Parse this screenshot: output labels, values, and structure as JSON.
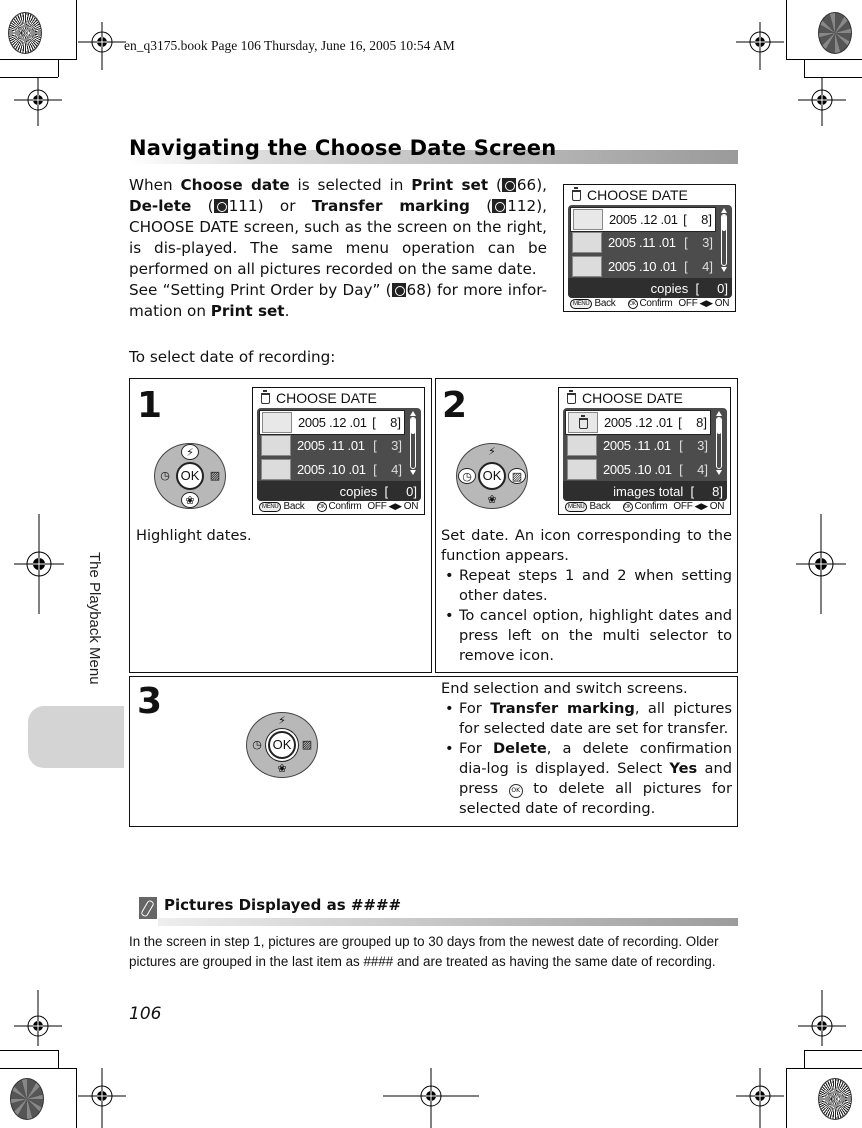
{
  "print_header": "en_q3175.book  Page 106  Thursday, June 16, 2005  10:54 AM",
  "side_tab_label": "The Playback Menu",
  "title": "Navigating the Choose Date Screen",
  "intro": {
    "p1_segments": [
      {
        "t": "When ",
        "b": false
      },
      {
        "t": "Choose date",
        "b": true
      },
      {
        "t": " is selected in ",
        "b": false
      },
      {
        "t": "Print set",
        "b": true
      },
      {
        "t": " (",
        "b": false
      },
      {
        "ref": "66"
      },
      {
        "t": "), ",
        "b": false
      },
      {
        "t": "De-lete",
        "b": true
      },
      {
        "t": " (",
        "b": false
      },
      {
        "ref": "111"
      },
      {
        "t": ") or ",
        "b": false
      },
      {
        "t": "Transfer marking",
        "b": true
      },
      {
        "t": " (",
        "b": false
      },
      {
        "ref": "112"
      },
      {
        "t": "), CHOOSE DATE screen, such as the screen on the right, is dis-played. The same menu operation can be performed on all pictures recorded on the same date.",
        "b": false
      }
    ],
    "p2_segments": [
      {
        "t": "See “Setting Print Order by Day” (",
        "b": false
      },
      {
        "ref": "68"
      },
      {
        "t": ") for more infor-mation on ",
        "b": false
      },
      {
        "t": "Print set",
        "b": true
      },
      {
        "t": ".",
        "b": false
      }
    ]
  },
  "lead": "To select date of recording:",
  "screens": {
    "intro": {
      "title": "CHOOSE DATE",
      "rows": [
        {
          "date": "2005 .12 .01",
          "count": "[    8]",
          "selected": true,
          "icon": false
        },
        {
          "date": "2005 .11 .01",
          "count": "[    3]",
          "selected": false,
          "icon": false
        },
        {
          "date": "2005 .10 .01",
          "count": "[    4]",
          "selected": false,
          "icon": false
        }
      ],
      "footer_label": "copies  [     0]",
      "bottom": {
        "back": "Back",
        "menu": "MENU",
        "ok": "OK",
        "confirm": "Confirm",
        "off": "OFF",
        "on": "ON"
      }
    },
    "step1": {
      "title": "CHOOSE DATE",
      "rows": [
        {
          "date": "2005 .12 .01",
          "count": "[    8]",
          "selected": true,
          "icon": false
        },
        {
          "date": "2005 .11 .01",
          "count": "[    3]",
          "selected": false,
          "icon": false
        },
        {
          "date": "2005 .10 .01",
          "count": "[    4]",
          "selected": false,
          "icon": false
        }
      ],
      "footer_label": "copies  [     0]",
      "bottom": {
        "back": "Back",
        "menu": "MENU",
        "ok": "OK",
        "confirm": "Confirm",
        "off": "OFF",
        "on": "ON"
      }
    },
    "step2": {
      "title": "CHOOSE DATE",
      "rows": [
        {
          "date": "2005 .12 .01",
          "count": "[    8]",
          "selected": true,
          "icon": true
        },
        {
          "date": "2005 .11 .01",
          "count": "[    3]",
          "selected": false,
          "icon": false
        },
        {
          "date": "2005 .10 .01",
          "count": "[    4]",
          "selected": false,
          "icon": false
        }
      ],
      "footer_label": "images total  [     8]",
      "bottom": {
        "back": "Back",
        "menu": "MENU",
        "ok": "OK",
        "confirm": "Confirm",
        "off": "OFF",
        "on": "ON"
      }
    }
  },
  "selector": {
    "ok": "OK",
    "up": "flash-icon",
    "down": "macro-icon",
    "left": "self-timer-icon",
    "right": "exposure-comp-icon"
  },
  "steps": [
    {
      "number": "1",
      "text": "Highlight dates.",
      "highlighted_buttons": [
        "up",
        "down"
      ]
    },
    {
      "number": "2",
      "intro": "Set date. An icon corresponding to the function appears.",
      "bullets": [
        "Repeat steps 1 and 2 when setting other dates.",
        "To cancel option, highlight dates and press left on the multi selector to remove icon."
      ],
      "highlighted_buttons": [
        "left",
        "right"
      ]
    },
    {
      "number": "3",
      "intro": "End selection and switch screens.",
      "bullet1": {
        "pre": "For ",
        "bold": "Transfer marking",
        "post": ", all pictures for selected date are set for transfer."
      },
      "bullet2": {
        "pre": "For ",
        "bold": "Delete",
        "mid": ", a delete confirmation dia-log is displayed. Select ",
        "bold2": "Yes",
        "mid2": " and press ",
        "ok": "OK",
        "post": " to delete all pictures for selected date of recording."
      },
      "highlighted_buttons": [
        "ok"
      ]
    }
  ],
  "note": {
    "icon": "pencil-note-icon",
    "title": "Pictures Displayed as ####",
    "body": "In the screen in step 1, pictures are grouped up to 30 days from the newest date of recording. Older pictures are grouped in the last item as #### and are treated as having the same date of recording."
  },
  "page_number": "106"
}
